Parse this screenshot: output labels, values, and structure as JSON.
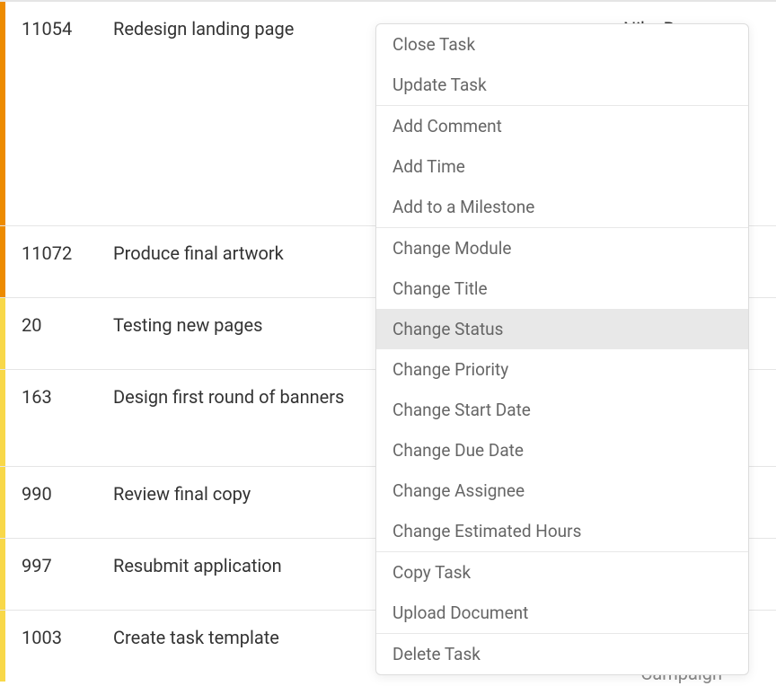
{
  "tasks": [
    {
      "id": "11054",
      "title": "Redesign landing page",
      "priority": "orange-dark",
      "height": "tall",
      "assignee": "Nike Bonner"
    },
    {
      "id": "11072",
      "title": "Produce final artwork",
      "priority": "orange-dark",
      "height": "",
      "assignee": ""
    },
    {
      "id": "20",
      "title": "Testing new pages",
      "priority": "yellow",
      "height": "",
      "assignee": ""
    },
    {
      "id": "163",
      "title": "Design first round of banners",
      "priority": "yellow",
      "height": "medium",
      "assignee": ""
    },
    {
      "id": "990",
      "title": "Review final copy",
      "priority": "yellow",
      "height": "",
      "assignee": ""
    },
    {
      "id": "997",
      "title": "Resubmit application",
      "priority": "yellow",
      "height": "",
      "assignee": ""
    },
    {
      "id": "1003",
      "title": "Create task template",
      "priority": "yellow",
      "height": "",
      "assignee": ""
    }
  ],
  "partial_bottom_text": "Campaign",
  "context_menu": {
    "groups": [
      {
        "items": [
          {
            "label": "Close Task",
            "highlighted": false
          },
          {
            "label": "Update Task",
            "highlighted": false
          }
        ]
      },
      {
        "items": [
          {
            "label": "Add Comment",
            "highlighted": false
          },
          {
            "label": "Add Time",
            "highlighted": false
          },
          {
            "label": "Add to a Milestone",
            "highlighted": false
          }
        ]
      },
      {
        "items": [
          {
            "label": "Change Module",
            "highlighted": false
          },
          {
            "label": "Change Title",
            "highlighted": false
          },
          {
            "label": "Change Status",
            "highlighted": true
          },
          {
            "label": "Change Priority",
            "highlighted": false
          },
          {
            "label": "Change Start Date",
            "highlighted": false
          },
          {
            "label": "Change Due Date",
            "highlighted": false
          },
          {
            "label": "Change Assignee",
            "highlighted": false
          },
          {
            "label": "Change Estimated Hours",
            "highlighted": false
          }
        ]
      },
      {
        "items": [
          {
            "label": "Copy Task",
            "highlighted": false
          },
          {
            "label": "Upload Document",
            "highlighted": false
          }
        ]
      },
      {
        "items": [
          {
            "label": "Delete Task",
            "highlighted": false
          }
        ]
      }
    ]
  }
}
